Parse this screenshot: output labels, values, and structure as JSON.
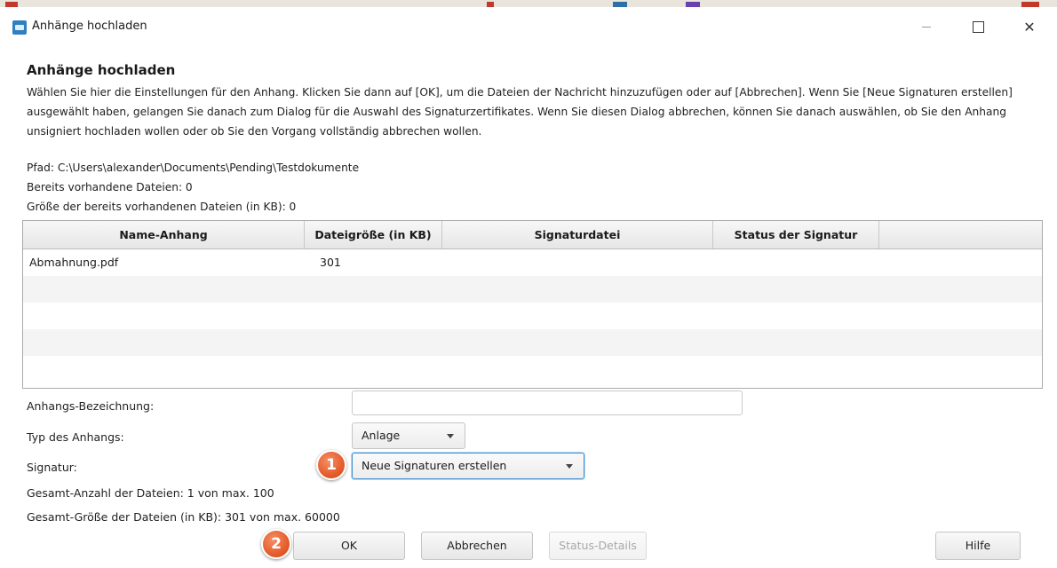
{
  "window": {
    "title": "Anhänge hochladen",
    "minimize_icon": "minimize-icon",
    "maximize_icon": "maximize-icon",
    "close_icon": "close-icon",
    "close_glyph": "✕"
  },
  "dialog": {
    "heading": "Anhänge hochladen",
    "description": "Wählen Sie hier die Einstellungen für den Anhang. Klicken Sie dann auf [OK], um die Dateien der Nachricht hinzuzufügen oder auf [Abbrechen]. Wenn Sie [Neue Signaturen erstellen] ausgewählt haben, gelangen Sie danach zum Dialog für die Auswahl des Signaturzertifikates. Wenn Sie diesen Dialog abbrechen, können Sie danach auswählen, ob Sie den Anhang unsigniert hochladen wollen oder ob Sie den Vorgang vollständig abbrechen wollen.",
    "path": "Pfad: C:\\Users\\alexander\\Documents\\Pending\\Testdokumente",
    "existing_files": "Bereits vorhandene Dateien: 0",
    "existing_size": "Größe der bereits vorhandenen Dateien (in KB): 0"
  },
  "table": {
    "columns": [
      "Name-Anhang",
      "Dateigröße (in KB)",
      "Signaturdatei",
      "Status der Signatur"
    ],
    "rows": [
      {
        "name": "Abmahnung.pdf",
        "size": "301",
        "signature_file": "",
        "status": ""
      }
    ]
  },
  "form": {
    "description_label": "Anhangs-Bezeichnung:",
    "description_value": "",
    "type_label": "Typ des Anhangs:",
    "type_value": "Anlage",
    "signature_label": "Signatur:",
    "signature_value": "Neue Signaturen erstellen"
  },
  "totals": {
    "count": "Gesamt-Anzahl der Dateien: 1 von max. 100",
    "size": "Gesamt-Größe der Dateien (in KB): 301 von max. 60000"
  },
  "buttons": {
    "ok": "OK",
    "cancel": "Abbrechen",
    "status_details": "Status-Details",
    "help": "Hilfe"
  },
  "annotations": {
    "badge1": "1",
    "badge2": "2",
    "color": "#e55d2c"
  }
}
